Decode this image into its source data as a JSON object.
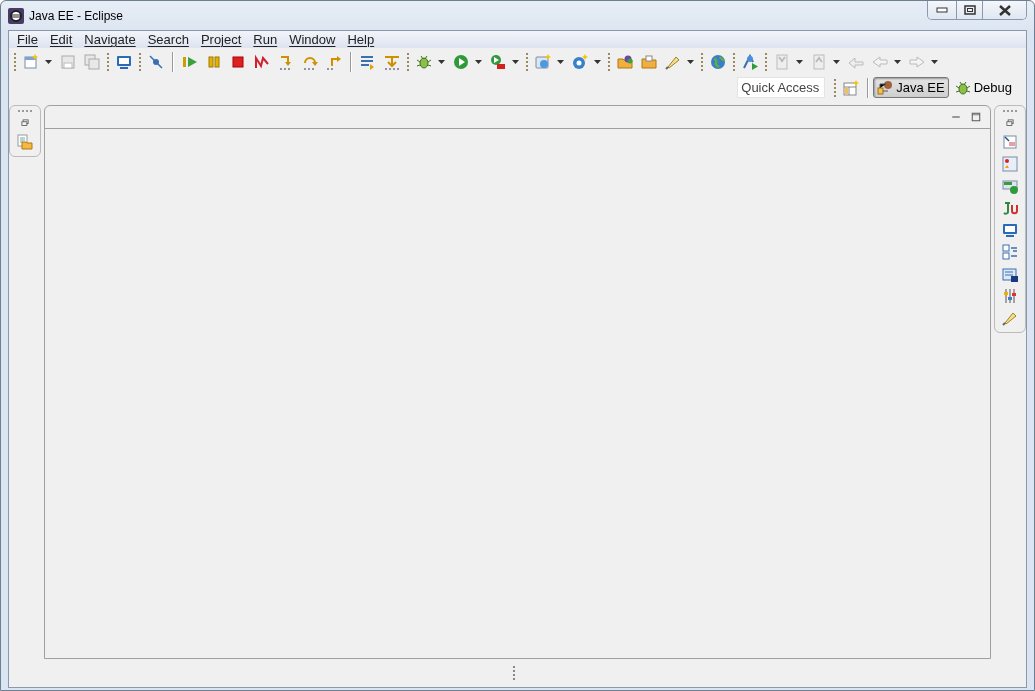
{
  "window": {
    "title": "Java EE - Eclipse"
  },
  "menu": [
    {
      "label": "File"
    },
    {
      "label": "Edit"
    },
    {
      "label": "Navigate"
    },
    {
      "label": "Search"
    },
    {
      "label": "Project"
    },
    {
      "label": "Run"
    },
    {
      "label": "Window"
    },
    {
      "label": "Help"
    }
  ],
  "quick_access": {
    "placeholder": "Quick Access"
  },
  "perspectives": [
    {
      "label": "Java EE",
      "selected": true
    },
    {
      "label": "Debug",
      "selected": false
    }
  ]
}
